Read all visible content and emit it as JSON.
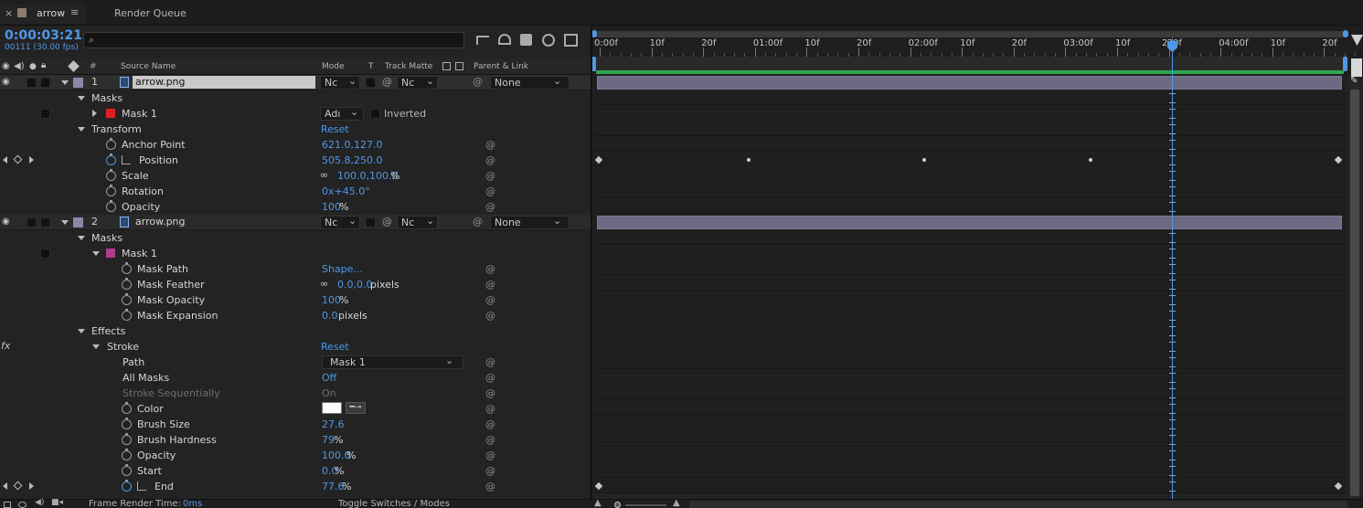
{
  "tabs": [
    {
      "label": "arrow"
    },
    {
      "label": "Render Queue"
    }
  ],
  "timecode": "0:00:03:21",
  "frame_info": "00111 (30.00 fps)",
  "search": {
    "placeholder": ""
  },
  "columns": {
    "number": "#",
    "source_name": "Source Name",
    "mode": "Mode",
    "t": "T",
    "track_matte": "Track Matte",
    "parent_link": "Parent & Link"
  },
  "ruler_labels": [
    "0:00f",
    "10f",
    "20f",
    "01:00f",
    "10f",
    "20f",
    "02:00f",
    "10f",
    "20f",
    "03:00f",
    "10f",
    "20f",
    "04:00f",
    "10f",
    "20f"
  ],
  "ruler_playhead_label": "2",
  "layer1": {
    "number": "1",
    "name": "arrow.png",
    "mode": "Nc",
    "matte": "Nc",
    "parent": "None"
  },
  "layer1_props": {
    "masks": "Masks",
    "mask1": "Mask 1",
    "mask1_mode": "Adı",
    "inverted": "Inverted",
    "transform": "Transform",
    "reset": "Reset",
    "anchor_label": "Anchor Point",
    "anchor_value": "621.0,127.0",
    "position_label": "Position",
    "position_value": "505.8,250.0",
    "scale_label": "Scale",
    "scale_value": "100.0,100.0",
    "scale_unit": "%",
    "rotation_label": "Rotation",
    "rotation_value": "0x+45.0°",
    "opacity_label": "Opacity",
    "opacity_value": "100",
    "opacity_unit": "%"
  },
  "layer2": {
    "number": "2",
    "name": "arrow.png",
    "mode": "Nc",
    "matte": "Nc",
    "parent": "None"
  },
  "layer2_props": {
    "masks": "Masks",
    "mask1": "Mask 1",
    "mask_path_label": "Mask Path",
    "mask_path_value": "Shape...",
    "feather_label": "Mask Feather",
    "feather_value": "0.0,0.0",
    "feather_unit": "pixels",
    "mopacity_label": "Mask Opacity",
    "mopacity_value": "100",
    "mopacity_unit": "%",
    "expansion_label": "Mask Expansion",
    "expansion_value": "0.0",
    "expansion_unit": "pixels"
  },
  "effects": {
    "label": "Effects",
    "fx": "fx",
    "stroke": "Stroke",
    "reset": "Reset",
    "path_label": "Path",
    "path_value": "Mask 1",
    "allmasks_label": "All Masks",
    "allmasks_value": "Off",
    "seq_label": "Stroke Sequentially",
    "seq_value": "On",
    "color_label": "Color",
    "color_value": "#ffffff",
    "bsize_label": "Brush Size",
    "bsize_value": "27.6",
    "bhard_label": "Brush Hardness",
    "bhard_value": "79",
    "bhard_unit": "%",
    "opacity_label": "Opacity",
    "opacity_value": "100.0",
    "opacity_unit": "%",
    "start_label": "Start",
    "start_value": "0.0",
    "start_unit": "%",
    "end_label": "End",
    "end_value": "77.6",
    "end_unit": "%"
  },
  "footer": {
    "render_time_label": "Frame Render Time:",
    "render_time_value": "0ms",
    "toggle_label": "Toggle Switches / Modes"
  },
  "colors": {
    "accent": "#4f97e8",
    "layer_bar": "#6b6a82",
    "work_area": "#2fa84f",
    "mask1_layer1": "#e02020",
    "mask1_layer2": "#b03c8c",
    "label_swatch": "#8a88a6"
  },
  "icons": [
    "close-icon",
    "menu-icon",
    "search-icon",
    "eye-icon",
    "audio-icon",
    "solo-icon",
    "lock-icon",
    "label-icon",
    "stopwatch-icon",
    "graph-icon",
    "spiral-pickwhip-icon",
    "eyedropper-icon",
    "chevron-down-icon"
  ]
}
